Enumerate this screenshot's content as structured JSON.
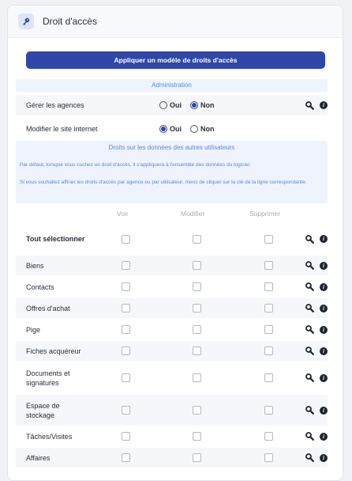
{
  "panel": {
    "title": "Droit d'accès"
  },
  "apply_button": "Appliquer un modèle de droits d'accès",
  "admin_section": {
    "title": "Administration",
    "rows": [
      {
        "label": "Gérer les agences",
        "yes": "Oui",
        "no": "Non",
        "selected": "Non"
      },
      {
        "label": "Modifier le site internet",
        "yes": "Oui",
        "no": "Non",
        "selected": "Oui"
      }
    ]
  },
  "data_section": {
    "title": "Droits sur les données des autres utilisateurs",
    "note1": "Par défaut, lorsque vous cochez un droit d'accès, il s'appliquera à l'ensemble des données du logiciel.",
    "note2": "Si vous souhaitez affiner les droits d'accès par agence ou par utilisateur, merci de cliquer sur la clé de la ligne correspondante.",
    "columns": [
      "Voir",
      "Modifier",
      "Supprimer"
    ],
    "rows": [
      {
        "label": "Tout sélectionner"
      },
      {
        "label": "Biens"
      },
      {
        "label": "Contacts"
      },
      {
        "label": "Offres d'achat"
      },
      {
        "label": "Pige"
      },
      {
        "label": "Fiches acquéreur"
      },
      {
        "label": "Documents et signatures"
      },
      {
        "label": "Espace de stockage"
      },
      {
        "label": "Tâches/Visites"
      },
      {
        "label": "Affaires"
      }
    ]
  },
  "colors": {
    "primary": "#2f47a8",
    "band": "#eef3fe",
    "band_text": "#5b86e0"
  },
  "icons": {
    "header": "key-icon",
    "row_search": "search-key-icon",
    "row_info": "info-icon"
  }
}
